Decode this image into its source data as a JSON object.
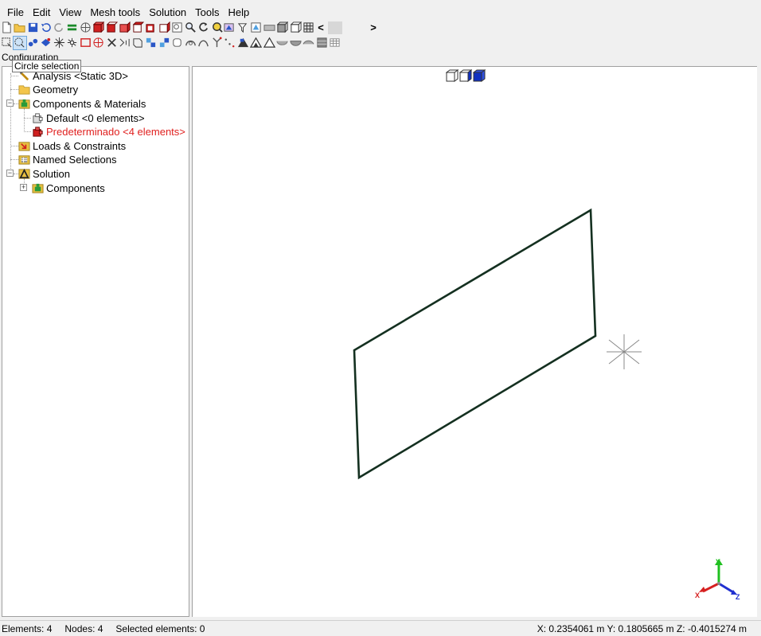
{
  "menu": [
    "File",
    "Edit",
    "View",
    "Mesh tools",
    "Solution",
    "Tools",
    "Help"
  ],
  "toolbar": {
    "row1_icons": [
      "new-file-icon",
      "open-folder-icon",
      "save-icon",
      "undo-icon",
      "redo-icon",
      "equals-icon",
      "wireframe-cube-icon",
      "red-cube-icon",
      "red-cube-front-icon",
      "red-cube-back-icon",
      "red-cube-left-icon",
      "red-cube-right-icon",
      "red-cube-top-icon",
      "zoom-box-icon",
      "zoom-icon",
      "rotate-icon",
      "zoom-extents-icon",
      "pan-icon",
      "selection-filter-icon",
      "view-fit-icon",
      "shaded-icon",
      "box-edges-icon",
      "box-hidden-icon",
      "grid-icon"
    ],
    "row2_icons": [
      "box-selection-icon",
      "circle-selection-icon",
      "node-select-icon",
      "element-select-icon",
      "star-mesh-icon",
      "node-spider-icon",
      "rectangle-icon",
      "red-wire-cube-icon",
      "delete-x-icon",
      "mirror-icon",
      "extrude-icon",
      "element-split-icon",
      "element-join-icon",
      "cylinder-icon",
      "loop-icon",
      "curve-icon",
      "branch-icon",
      "dots-icon",
      "mesh-triangle-icon",
      "triangle-filled-icon",
      "triangle-outline-icon",
      "shell-icon",
      "bowl-icon",
      "surface-icon",
      "block-icon",
      "table-icon"
    ],
    "scroll_left": "<",
    "scroll_right": ">"
  },
  "tooltip": "Circle selection",
  "panel_title": "Configuration",
  "tree": [
    {
      "label": "Analysis <Static 3D>",
      "icon": "analysis-icon",
      "level": 1,
      "color": "normal"
    },
    {
      "label": "Geometry",
      "icon": "folder-icon",
      "level": 1,
      "color": "normal"
    },
    {
      "label": "Components & Materials",
      "icon": "components-icon",
      "level": 1,
      "expanded": true,
      "color": "normal"
    },
    {
      "label": "Default <0 elements>",
      "icon": "material-gray-icon",
      "level": 2,
      "color": "normal"
    },
    {
      "label": "Predeterminado <4 elements>",
      "icon": "material-red-icon",
      "level": 2,
      "color": "red"
    },
    {
      "label": "Loads & Constraints",
      "icon": "loads-icon",
      "level": 1,
      "color": "normal"
    },
    {
      "label": "Named Selections",
      "icon": "named-selections-icon",
      "level": 1,
      "color": "normal"
    },
    {
      "label": "Solution",
      "icon": "solution-icon",
      "level": 1,
      "expanded": true,
      "color": "normal"
    },
    {
      "label": "Components",
      "icon": "components-icon",
      "level": 2,
      "collapsed": true,
      "color": "normal"
    }
  ],
  "view_buttons": [
    "view-wire-box-icon",
    "view-solid-box-icon",
    "view-blue-box-icon"
  ],
  "axes": {
    "x": "X",
    "y": "Y",
    "z": "Z",
    "x_color": "#d62020",
    "y_color": "#20c020",
    "z_color": "#2030d0"
  },
  "status": {
    "elements": "Elements: 4",
    "nodes": "Nodes: 4",
    "selected": "Selected elements: 0",
    "coords": "X: 0.2354061 m Y: 0.1805665 m Z: -0.4015274 m"
  }
}
